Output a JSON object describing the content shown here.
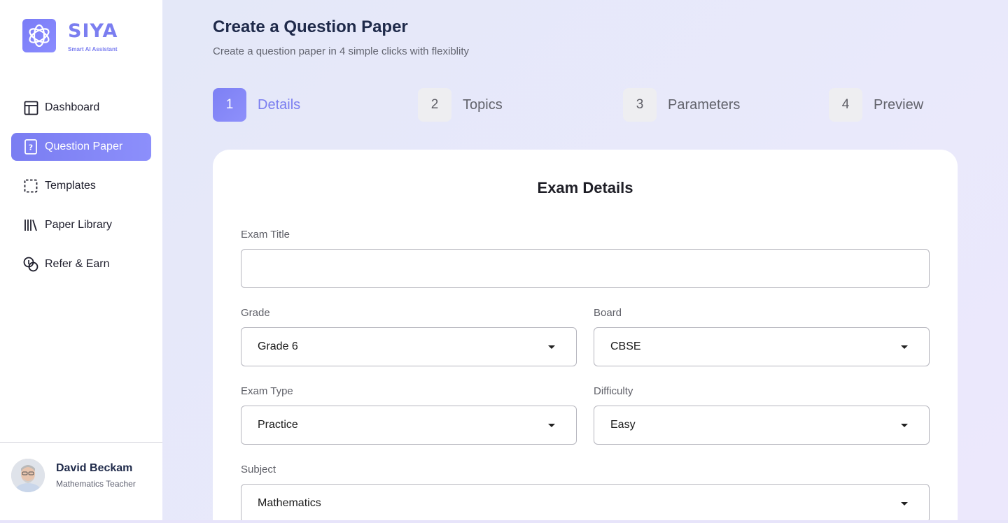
{
  "brand": {
    "name": "SIYA",
    "tagline": "Smart AI Assistant"
  },
  "sidebar": {
    "items": [
      {
        "label": "Dashboard",
        "icon": "layout-icon",
        "active": false
      },
      {
        "label": "Question Paper",
        "icon": "question-doc-icon",
        "active": true
      },
      {
        "label": "Templates",
        "icon": "dashed-square-icon",
        "active": false
      },
      {
        "label": "Paper Library",
        "icon": "library-icon",
        "active": false
      },
      {
        "label": "Refer & Earn",
        "icon": "coins-icon",
        "active": false
      }
    ]
  },
  "user": {
    "name": "David Beckam",
    "role": "Mathematics Teacher"
  },
  "header": {
    "title": "Create a Question Paper",
    "subtitle": "Create a question paper in 4 simple clicks with flexiblity"
  },
  "steps": [
    {
      "number": "1",
      "label": "Details",
      "active": true
    },
    {
      "number": "2",
      "label": "Topics",
      "active": false
    },
    {
      "number": "3",
      "label": "Parameters",
      "active": false
    },
    {
      "number": "4",
      "label": "Preview",
      "active": false
    }
  ],
  "form": {
    "title": "Exam Details",
    "exam_title": {
      "label": "Exam Title",
      "value": ""
    },
    "grade": {
      "label": "Grade",
      "value": "Grade 6"
    },
    "board": {
      "label": "Board",
      "value": "CBSE"
    },
    "exam_type": {
      "label": "Exam Type",
      "value": "Practice"
    },
    "difficulty": {
      "label": "Difficulty",
      "value": "Easy"
    },
    "subject": {
      "label": "Subject",
      "value": "Mathematics"
    }
  },
  "colors": {
    "accent": "#7b7ef0",
    "heading": "#1f2a4a"
  }
}
